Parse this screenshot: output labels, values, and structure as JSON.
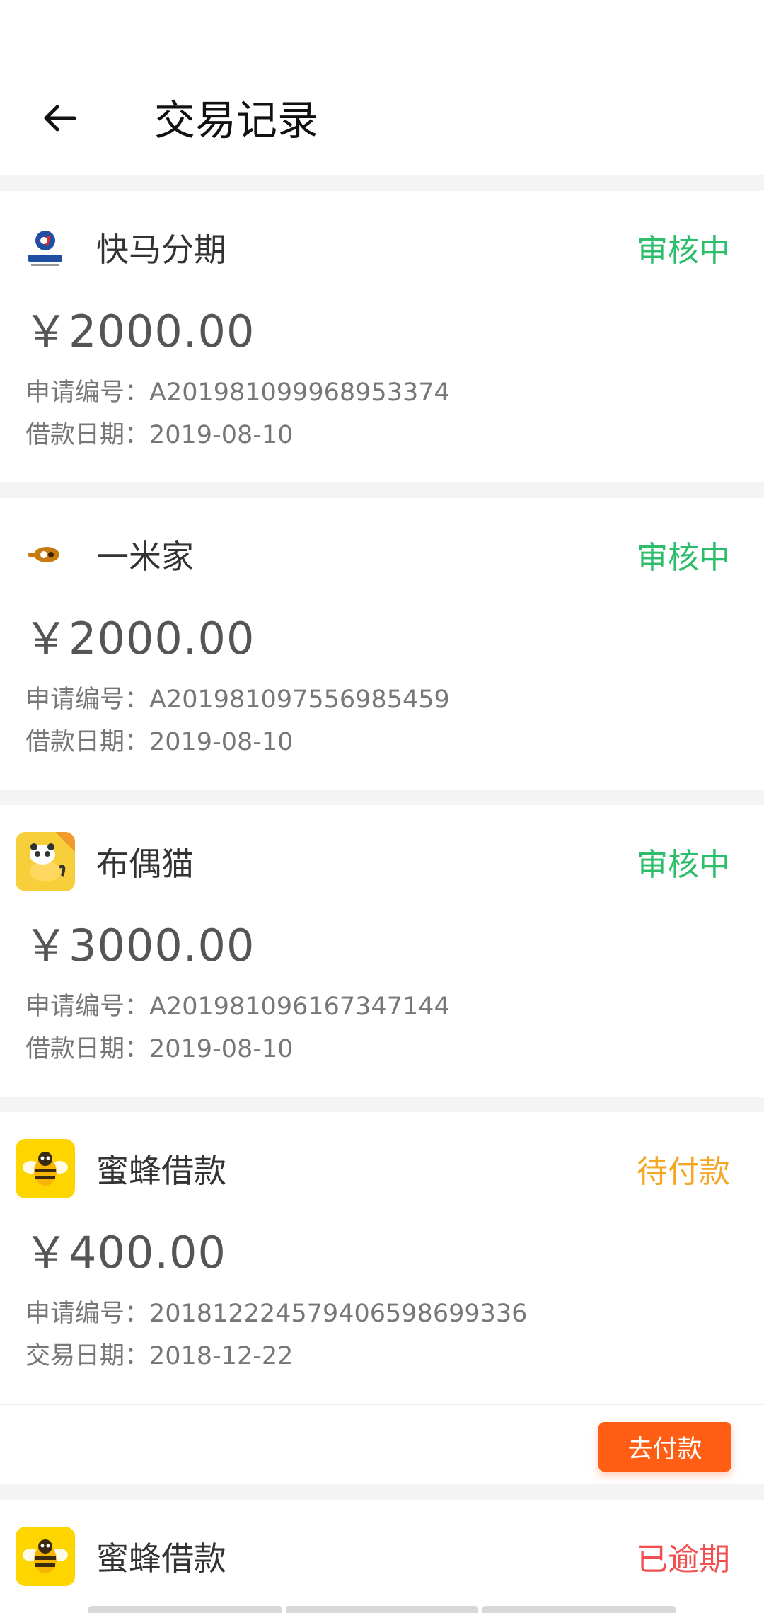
{
  "header": {
    "title": "交易记录",
    "back_icon": "arrow-left-icon"
  },
  "records": [
    {
      "merchant": "快马分期",
      "logo": "kuaima-logo",
      "status": "审核中",
      "status_color": "#2dbe6c",
      "amount": "￥2000.00",
      "line1": "申请编号：A201981099968953374",
      "line2": "借款日期：2019-08-10"
    },
    {
      "merchant": "一米家",
      "logo": "yimijia-logo",
      "status": "审核中",
      "status_color": "#2dbe6c",
      "amount": "￥2000.00",
      "line1": "申请编号：A201981097556985459",
      "line2": "借款日期：2019-08-10"
    },
    {
      "merchant": "布偶猫",
      "logo": "buoumao-logo",
      "status": "审核中",
      "status_color": "#2dbe6c",
      "amount": "￥3000.00",
      "line1": "申请编号：A201981096167347144",
      "line2": "借款日期：2019-08-10"
    },
    {
      "merchant": "蜜蜂借款",
      "logo": "bee-logo",
      "status": "待付款",
      "status_color": "#f5a623",
      "amount": "￥400.00",
      "line1": "申请编号：2018122245794065986993​36",
      "line2": "交易日期：2018-12-22",
      "action": "去付款"
    },
    {
      "merchant": "蜜蜂借款",
      "logo": "bee-logo",
      "status": "已逾期",
      "status_color": "#f0504f"
    }
  ]
}
